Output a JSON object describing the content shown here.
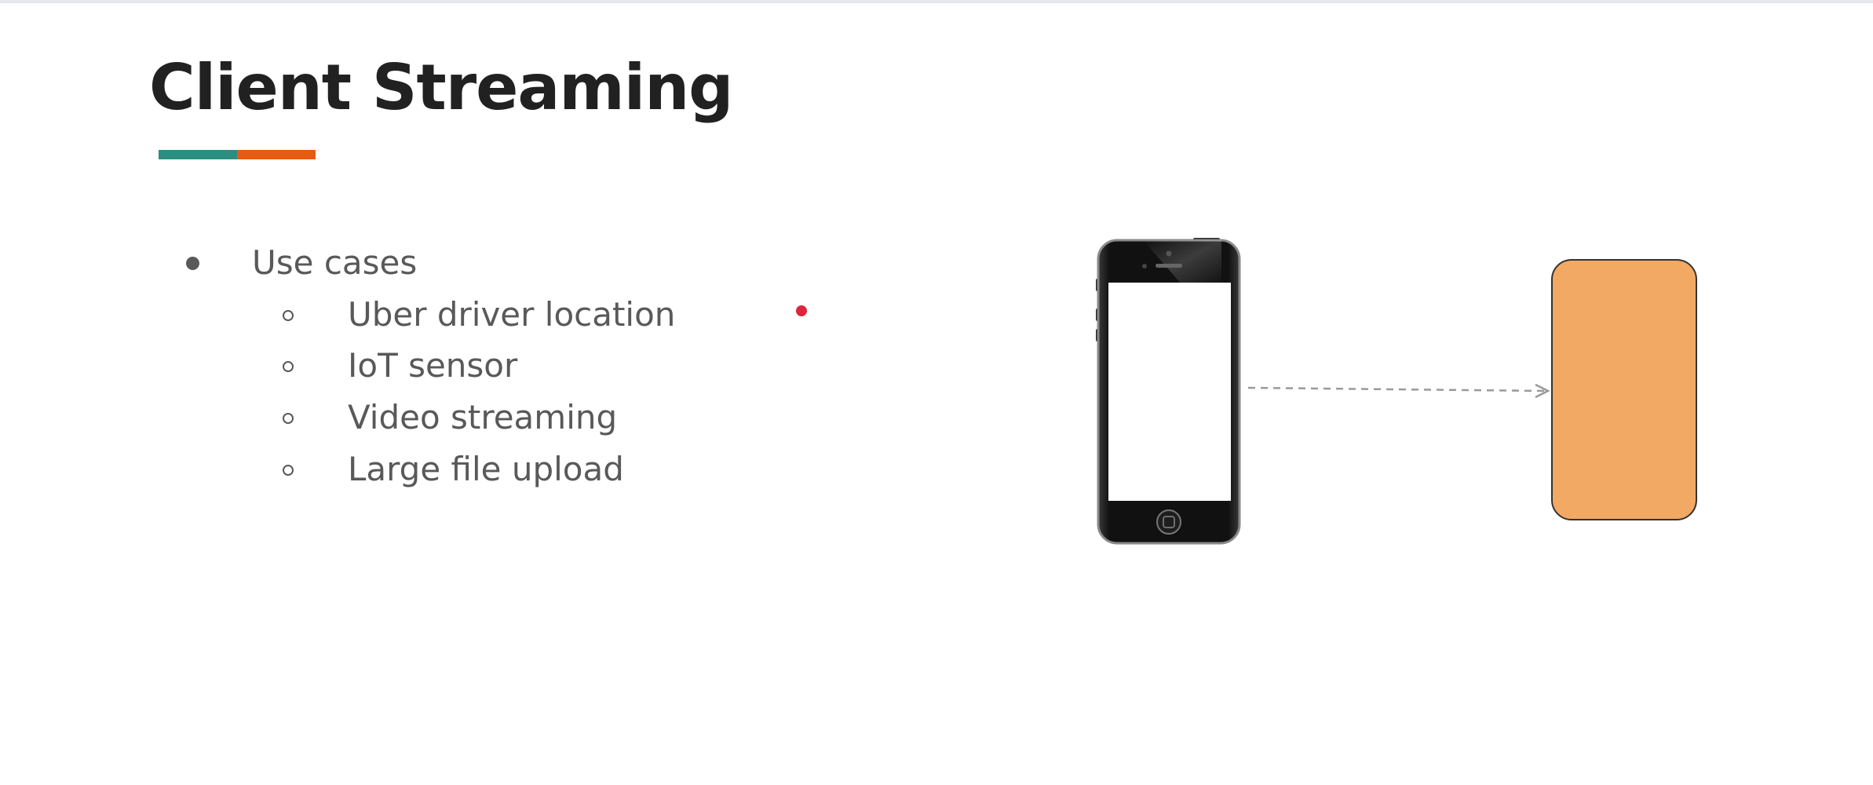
{
  "slide": {
    "title": "Client Streaming",
    "accent_colors": {
      "teal": "#2a8f82",
      "orange": "#e65a12"
    },
    "bullet": {
      "label": "Use cases",
      "sub_items": [
        "Uber driver location",
        "IoT sensor",
        "Video streaming",
        "Large file upload"
      ]
    }
  },
  "diagram": {
    "client_icon": "smartphone-icon",
    "server_color": "#f2a964",
    "arrow_color": "#9a9a9a",
    "arrow_style": "dashed"
  },
  "pointer": {
    "icon": "laser-pointer-dot",
    "color": "#e0243c"
  }
}
